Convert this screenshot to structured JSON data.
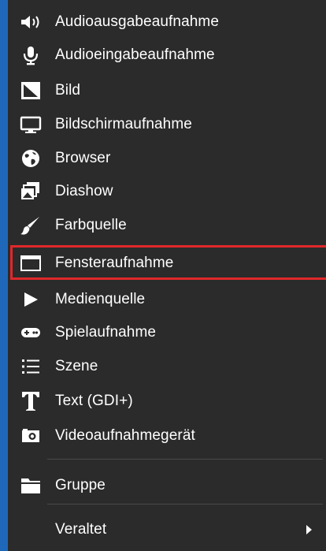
{
  "menu": {
    "items": [
      {
        "label": "Audioausgabeaufnahme",
        "icon": "speaker-icon"
      },
      {
        "label": "Audioeingabeaufnahme",
        "icon": "microphone-icon"
      },
      {
        "label": "Bild",
        "icon": "image-icon"
      },
      {
        "label": "Bildschirmaufnahme",
        "icon": "monitor-icon"
      },
      {
        "label": "Browser",
        "icon": "globe-icon"
      },
      {
        "label": "Diashow",
        "icon": "slideshow-icon"
      },
      {
        "label": "Farbquelle",
        "icon": "paintbrush-icon"
      },
      {
        "label": "Fensteraufnahme",
        "icon": "window-icon"
      },
      {
        "label": "Medienquelle",
        "icon": "play-icon"
      },
      {
        "label": "Spielaufnahme",
        "icon": "gamepad-icon"
      },
      {
        "label": "Szene",
        "icon": "list-icon"
      },
      {
        "label": "Text (GDI+)",
        "icon": "text-icon"
      },
      {
        "label": "Videoaufnahmegerät",
        "icon": "camera-icon"
      },
      {
        "label": "Gruppe",
        "icon": "folder-icon"
      },
      {
        "label": "Veraltet",
        "icon": "",
        "submenu": true
      }
    ]
  },
  "colors": {
    "menu_background": "#2b2b2b",
    "highlight_border": "#e0272b",
    "left_border": "#1f68b9",
    "text": "#ffffff"
  }
}
